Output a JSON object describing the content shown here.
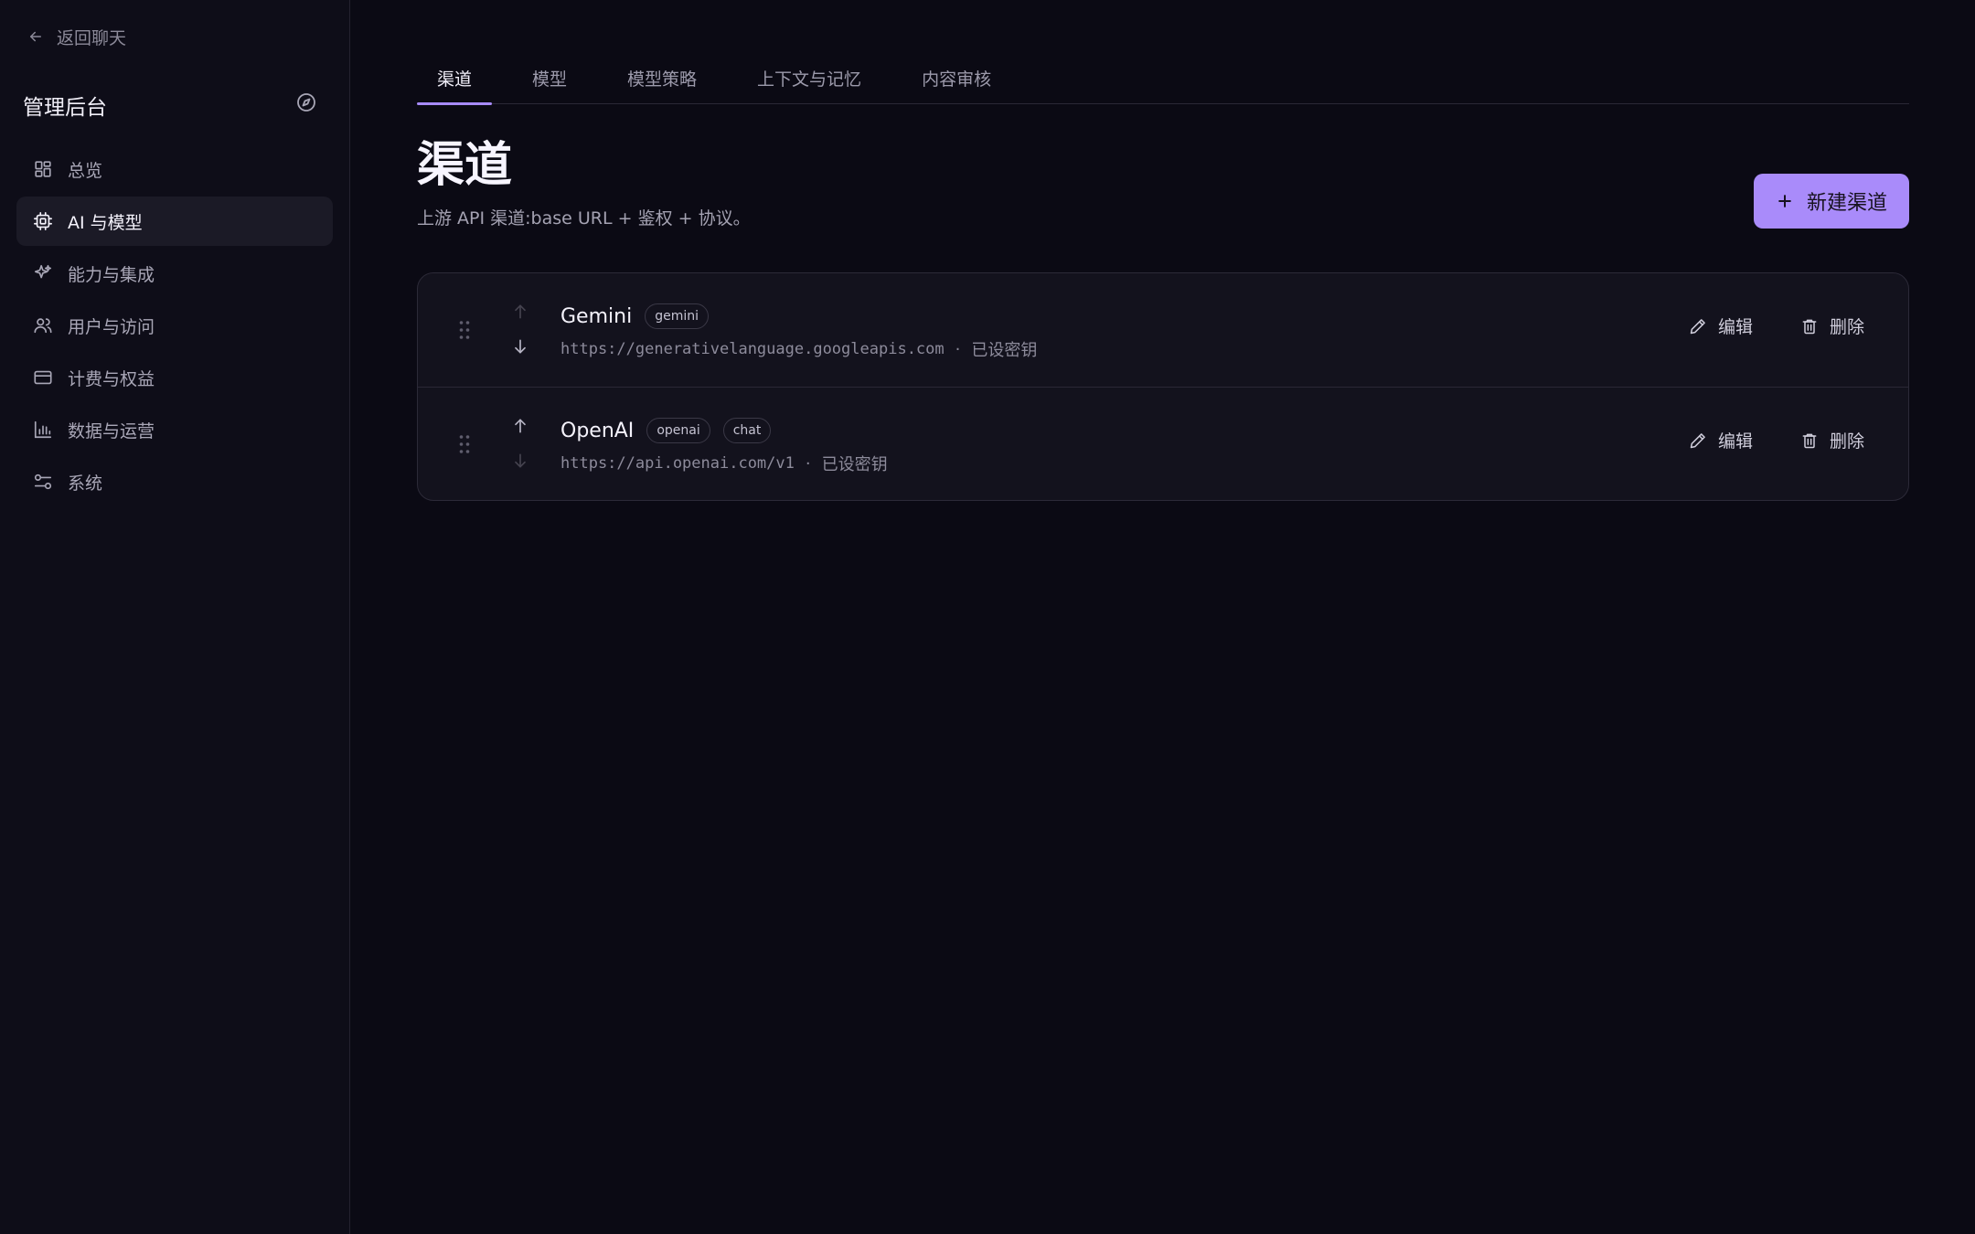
{
  "sidebar": {
    "back_label": "返回聊天",
    "title": "管理后台",
    "items": [
      {
        "label": "总览",
        "icon": "dashboard-icon",
        "active": false
      },
      {
        "label": "AI 与模型",
        "icon": "chip-icon",
        "active": true
      },
      {
        "label": "能力与集成",
        "icon": "sparkles-icon",
        "active": false
      },
      {
        "label": "用户与访问",
        "icon": "users-icon",
        "active": false
      },
      {
        "label": "计费与权益",
        "icon": "credit-card-icon",
        "active": false
      },
      {
        "label": "数据与运营",
        "icon": "bar-chart-icon",
        "active": false
      },
      {
        "label": "系统",
        "icon": "sliders-icon",
        "active": false
      }
    ]
  },
  "tabs": [
    {
      "label": "渠道",
      "active": true
    },
    {
      "label": "模型",
      "active": false
    },
    {
      "label": "模型策略",
      "active": false
    },
    {
      "label": "上下文与记忆",
      "active": false
    },
    {
      "label": "内容审核",
      "active": false
    }
  ],
  "page": {
    "title": "渠道",
    "subtitle": "上游 API 渠道:base URL + 鉴权 + 协议。",
    "new_button_label": "新建渠道"
  },
  "channels": [
    {
      "name": "Gemini",
      "tags": [
        "gemini"
      ],
      "url": "https://generativelanguage.googleapis.com",
      "separator": "·",
      "key_status": "已设密钥",
      "up_enabled": false,
      "down_enabled": true
    },
    {
      "name": "OpenAI",
      "tags": [
        "openai",
        "chat"
      ],
      "url": "https://api.openai.com/v1",
      "separator": "·",
      "key_status": "已设密钥",
      "up_enabled": true,
      "down_enabled": false
    }
  ],
  "row_actions": {
    "edit_label": "编辑",
    "delete_label": "删除"
  },
  "colors": {
    "accent": "#a98bfa",
    "background": "#0b0a14",
    "sidebar": "#0e0d18"
  }
}
